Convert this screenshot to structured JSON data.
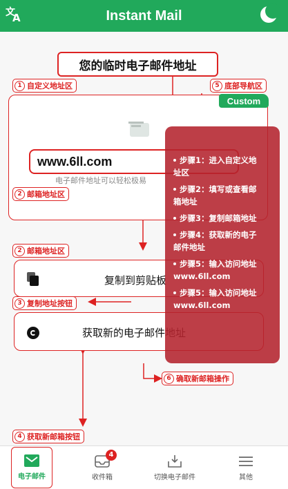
{
  "app": {
    "title": "Instant Mail"
  },
  "header_label": "您的临时电子邮件地址",
  "tags": {
    "t1": {
      "num": "1",
      "label": "自定义地址区"
    },
    "t5": {
      "num": "5",
      "label": "底部导航区"
    },
    "t2a": {
      "num": "2",
      "label": "邮箱地址区"
    },
    "t2b": {
      "num": "2",
      "label": "邮箱地址区"
    },
    "t3": {
      "num": "3",
      "label": "复制地址按钮"
    },
    "t6": {
      "num": "6",
      "label": "确取新邮箱操作"
    },
    "t4": {
      "num": "4",
      "label": "获取新邮箱按钮"
    }
  },
  "custom_button": "Custom",
  "email": {
    "address": "www.6ll.com",
    "hint": "电子邮件地址可以轻松极易"
  },
  "buttons": {
    "copy": "复制到剪贴板",
    "new_address": "获取新的电子邮件地址"
  },
  "steps": [
    {
      "title": "步骤1：进入自定义地",
      "rest": "址区"
    },
    {
      "title": "步骤2：填写或查看邮",
      "rest": "箱地址"
    },
    {
      "title": "步骤3：复制邮箱地址",
      "rest": ""
    },
    {
      "title": "步骤4：获取新的电子",
      "rest": "邮件地址"
    },
    {
      "title": "步骤5：输入访问地址",
      "rest": "www.6ll.com"
    },
    {
      "title": "步骤5：输入访问地址",
      "rest": "www.6ll.com"
    }
  ],
  "nav": {
    "mail": "电子邮件",
    "inbox": "收件箱",
    "inbox_badge": "4",
    "switch": "切换电子邮件",
    "other": "其他"
  },
  "colors": {
    "brand": "#21a95b",
    "annotation": "#dd2222",
    "overlay": "#b4232d"
  }
}
